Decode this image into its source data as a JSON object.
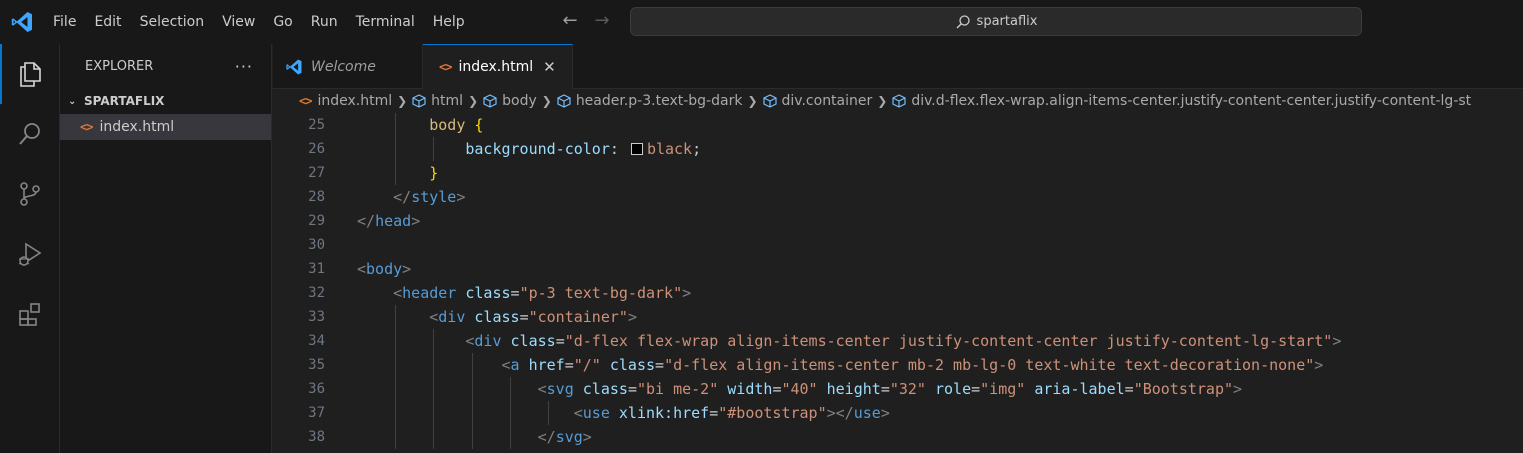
{
  "titlebar": {
    "menu": [
      "File",
      "Edit",
      "Selection",
      "View",
      "Go",
      "Run",
      "Terminal",
      "Help"
    ],
    "search_text": "spartaflix",
    "accent": "#0078d4"
  },
  "activitybar": {
    "icons": [
      "explorer-icon",
      "search-icon",
      "source-control-icon",
      "run-debug-icon",
      "extensions-icon"
    ]
  },
  "sidebar": {
    "title": "EXPLORER",
    "more": "···",
    "folder": "SPARTAFLIX",
    "files": [
      {
        "icon": "<>",
        "name": "index.html"
      }
    ]
  },
  "tabs": [
    {
      "label": "Welcome",
      "active": false
    },
    {
      "label": "index.html",
      "active": true,
      "icon": "<>",
      "close": "✕"
    }
  ],
  "breadcrumbs": {
    "file": "index.html",
    "items": [
      "html",
      "body",
      "header.p-3.text-bg-dark",
      "div.container",
      "div.d-flex.flex-wrap.align-items-center.justify-content-center.justify-content-lg-st"
    ]
  },
  "code": {
    "line_numbers": [
      "25",
      "26",
      "27",
      "28",
      "29",
      "30",
      "31",
      "32",
      "33",
      "34",
      "35",
      "36",
      "37",
      "38"
    ],
    "lines": [
      "        body {",
      "            background-color:  black;",
      "        }",
      "    </style>",
      "</head>",
      "",
      "<body>",
      "    <header class=\"p-3 text-bg-dark\">",
      "        <div class=\"container\">",
      "            <div class=\"d-flex flex-wrap align-items-center justify-content-center justify-content-lg-start\">",
      "                <a href=\"/\" class=\"d-flex align-items-center mb-2 mb-lg-0 text-white text-decoration-none\">",
      "                    <svg class=\"bi me-2\" width=\"40\" height=\"32\" role=\"img\" aria-label=\"Bootstrap\">",
      "                        <use xlink:href=\"#bootstrap\"></use>",
      "                    </svg>"
    ]
  }
}
